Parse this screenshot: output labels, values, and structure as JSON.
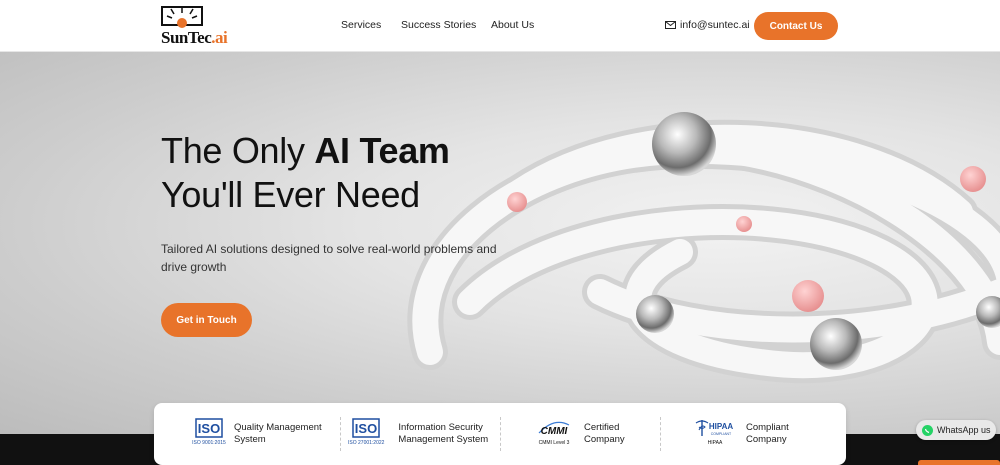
{
  "header": {
    "logo": {
      "name": "Sun",
      "name2": "Tec",
      "dot_ai": ".ai"
    },
    "nav": [
      {
        "label": "Services"
      },
      {
        "label": "Success Stories"
      },
      {
        "label": "About Us"
      }
    ],
    "email": "info@suntec.ai",
    "contact_label": "Contact Us"
  },
  "hero": {
    "title_line1_normal": "The Only ",
    "title_line1_bold": "AI Team",
    "title_line2": "You'll Ever Need",
    "subtitle": "Tailored AI solutions designed to solve real-world problems and drive growth",
    "cta_label": "Get in Touch"
  },
  "certifications": [
    {
      "logo_text": "ISO",
      "logo_caption": "ISO 9001:2015",
      "line1": "Quality Management",
      "line2": "System"
    },
    {
      "logo_text": "ISO",
      "logo_caption": "ISO 27001:2022",
      "line1": "Information Security",
      "line2": "Management System"
    },
    {
      "logo_text": "CMMI",
      "logo_caption": "CMMI Level 3",
      "line1": "Certified",
      "line2": "Company"
    },
    {
      "logo_text": "HIPAA",
      "logo_caption": "HIPAA",
      "logo_sub": "COMPLIANT",
      "line1": "Compliant",
      "line2": "Company"
    }
  ],
  "whatsapp": {
    "label": "WhatsApp us"
  },
  "colors": {
    "accent": "#e8732a",
    "dark": "#111111",
    "iso_blue": "#1f4fa0",
    "whatsapp": "#25d366"
  }
}
